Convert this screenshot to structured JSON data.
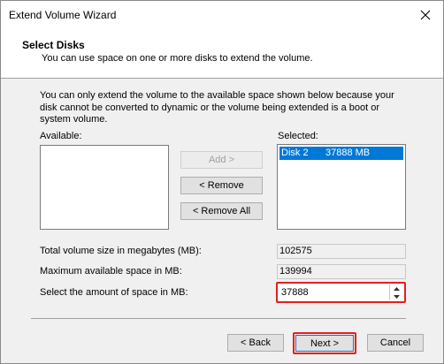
{
  "window": {
    "title": "Extend Volume Wizard"
  },
  "header": {
    "title": "Select Disks",
    "subtitle": "You can use space on one or more disks to extend the volume."
  },
  "info_text": "You can only extend the volume to the available space shown below because your disk cannot be converted to dynamic or the volume being extended is a boot or system volume.",
  "available": {
    "label": "Available:"
  },
  "selected": {
    "label": "Selected:",
    "items": [
      {
        "disk": "Disk 2",
        "size": "37888 MB"
      }
    ]
  },
  "buttons": {
    "add": "Add >",
    "remove": "< Remove",
    "remove_all": "< Remove All",
    "back": "< Back",
    "next": "Next >",
    "cancel": "Cancel"
  },
  "fields": {
    "total_label": "Total volume size in megabytes (MB):",
    "total_value": "102575",
    "max_label": "Maximum available space in MB:",
    "max_value": "139994",
    "amount_label": "Select the amount of space in MB:",
    "amount_value": "37888"
  },
  "colors": {
    "selection": "#0078d7",
    "highlight": "#e02020"
  }
}
